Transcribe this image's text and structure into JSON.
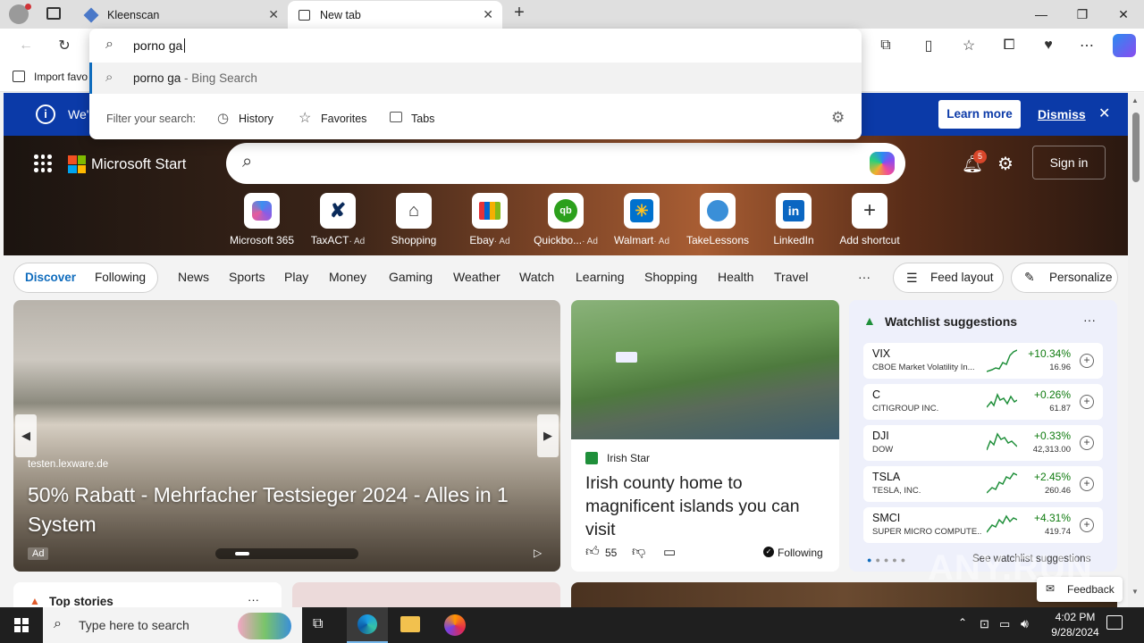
{
  "tabs": [
    {
      "title": "Kleenscan"
    },
    {
      "title": "New tab"
    }
  ],
  "address": {
    "value": "porno ga"
  },
  "suggestion": {
    "query": "porno ga",
    "suffix": " - Bing Search"
  },
  "filter": {
    "label": "Filter your search:",
    "history": "History",
    "favorites": "Favorites",
    "tabs": "Tabs"
  },
  "favbar": {
    "import": "Import favo"
  },
  "banner": {
    "partial": "We'",
    "learn_more": "Learn more",
    "dismiss": "Dismiss"
  },
  "brand": "Microsoft Start",
  "header": {
    "notif_count": "5",
    "sign_in": "Sign in"
  },
  "shortcuts": [
    {
      "label": "Microsoft 365",
      "ad": ""
    },
    {
      "label": "TaxACT",
      "ad": "· Ad"
    },
    {
      "label": "Shopping",
      "ad": ""
    },
    {
      "label": "Ebay",
      "ad": "· Ad"
    },
    {
      "label": "Quickbo...",
      "ad": "· Ad"
    },
    {
      "label": "Walmart",
      "ad": "· Ad"
    },
    {
      "label": "TakeLessons",
      "ad": ""
    },
    {
      "label": "LinkedIn",
      "ad": ""
    },
    {
      "label": "Add shortcut",
      "ad": ""
    }
  ],
  "nav": {
    "discover": "Discover",
    "following": "Following",
    "items": [
      "News",
      "Sports",
      "Play",
      "Money",
      "Gaming",
      "Weather",
      "Watch",
      "Learning",
      "Shopping",
      "Health",
      "Travel"
    ],
    "more": "···",
    "feed_layout": "Feed layout",
    "personalize": "Personalize"
  },
  "bigcard": {
    "source": "testen.lexware.de",
    "headline": "50% Rabatt - Mehrfacher Testsieger 2024 - Alles in 1 System",
    "ad": "Ad"
  },
  "irish": {
    "source": "Irish Star",
    "headline": "Irish county home to magnificent islands you can visit",
    "likes": "55",
    "following": "Following"
  },
  "watchlist": {
    "title": "Watchlist suggestions",
    "more": "···",
    "see_all": "See watchlist suggestions",
    "items": [
      {
        "sym": "VIX",
        "name": "CBOE Market Volatility In...",
        "pct": "+10.34%",
        "price": "16.96"
      },
      {
        "sym": "C",
        "name": "CITIGROUP INC.",
        "pct": "+0.26%",
        "price": "61.87"
      },
      {
        "sym": "DJI",
        "name": "DOW",
        "pct": "+0.33%",
        "price": "42,313.00"
      },
      {
        "sym": "TSLA",
        "name": "TESLA, INC.",
        "pct": "+2.45%",
        "price": "260.46"
      },
      {
        "sym": "SMCI",
        "name": "SUPER MICRO COMPUTE...",
        "pct": "+4.31%",
        "price": "419.74"
      }
    ]
  },
  "stories": {
    "title": "Top stories",
    "more": "···"
  },
  "feedback": "Feedback",
  "watermark": "ANY.RUN",
  "taskbar": {
    "search_placeholder": "Type here to search",
    "time": "4:02 PM",
    "date": "9/28/2024"
  },
  "colors": {
    "accent": "#0f6cbd",
    "banner": "#0b3aa8",
    "green": "#0f7b0f"
  }
}
